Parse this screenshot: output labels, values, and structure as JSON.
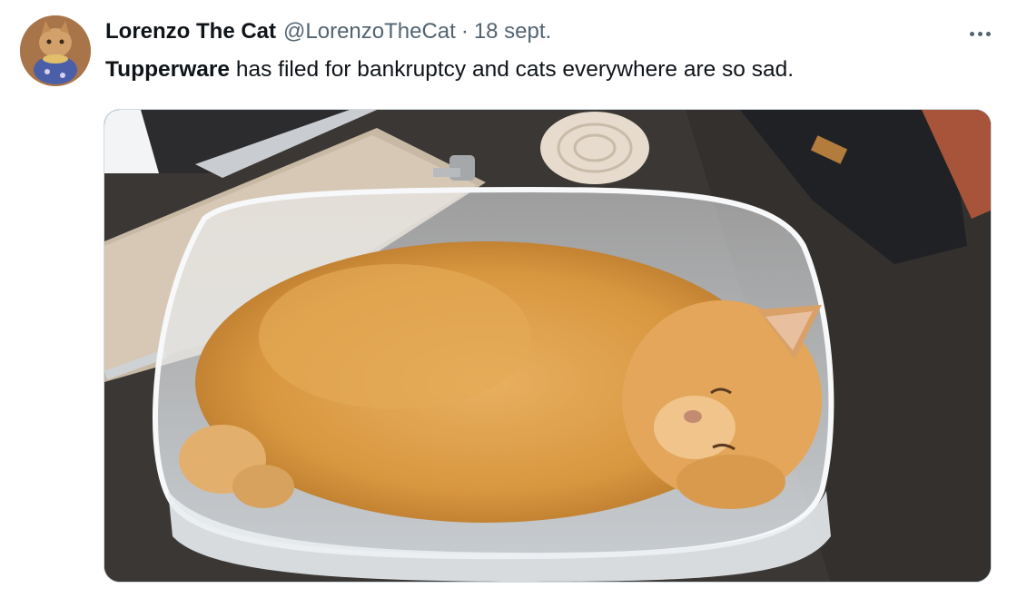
{
  "tweet": {
    "author_name": "Lorenzo The Cat",
    "author_handle": "@LorenzoTheCat",
    "separator": "·",
    "date": "18 sept.",
    "text_bold": "Tupperware",
    "text_rest": " has filed for bankruptcy and cats everywhere are so sad.",
    "more_icon": "more-horizontal-icon"
  },
  "colors": {
    "text_primary": "#0f1419",
    "text_secondary": "#536471",
    "border": "#cfd9de"
  }
}
